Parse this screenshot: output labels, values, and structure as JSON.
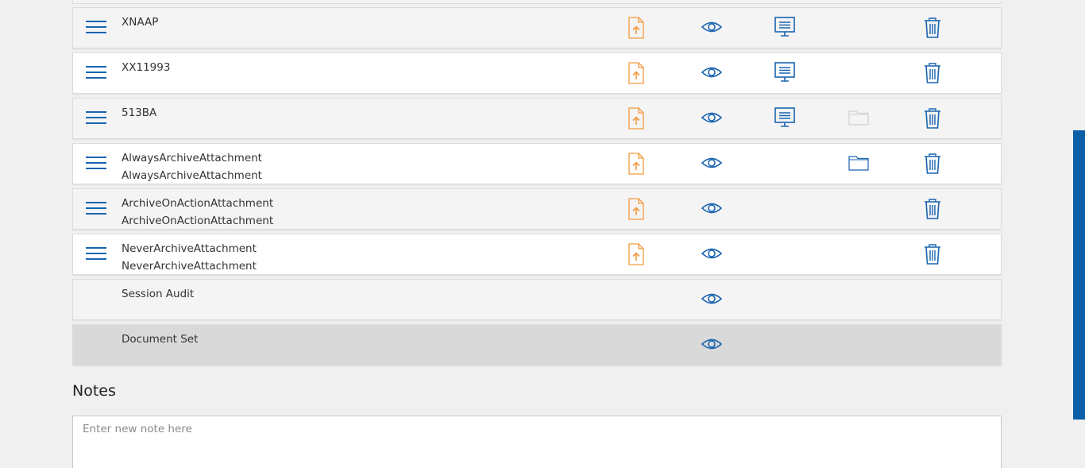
{
  "colors": {
    "accent": "#1a64b0",
    "upload": "#f39a3b",
    "folder_disabled": "#cfcfcf",
    "scrollbar": "#0b5ea8",
    "selected_row": "#d9d9d9"
  },
  "attachments": [
    {
      "line1": "XNAAP",
      "line2": "",
      "style": "gray",
      "icons": {
        "handle": true,
        "upload": true,
        "view": true,
        "present": true,
        "folder": "none",
        "delete": true
      }
    },
    {
      "line1": "XX11993",
      "line2": "",
      "style": "white",
      "icons": {
        "handle": true,
        "upload": true,
        "view": true,
        "present": true,
        "folder": "none",
        "delete": true
      }
    },
    {
      "line1": "513BA",
      "line2": "",
      "style": "gray",
      "icons": {
        "handle": true,
        "upload": true,
        "view": true,
        "present": true,
        "folder": "disabled",
        "delete": true
      }
    },
    {
      "line1": "AlwaysArchiveAttachment",
      "line2": "AlwaysArchiveAttachment",
      "style": "white",
      "icons": {
        "handle": true,
        "upload": true,
        "view": true,
        "present": false,
        "folder": "active",
        "delete": true
      }
    },
    {
      "line1": "ArchiveOnActionAttachment",
      "line2": "ArchiveOnActionAttachment",
      "style": "gray",
      "icons": {
        "handle": true,
        "upload": true,
        "view": true,
        "present": false,
        "folder": "none",
        "delete": true
      }
    },
    {
      "line1": "NeverArchiveAttachment",
      "line2": "NeverArchiveAttachment",
      "style": "white",
      "icons": {
        "handle": true,
        "upload": true,
        "view": true,
        "present": false,
        "folder": "none",
        "delete": true
      }
    },
    {
      "line1": "Session Audit",
      "line2": "",
      "style": "gray",
      "icons": {
        "handle": false,
        "upload": false,
        "view": true,
        "present": false,
        "folder": "none",
        "delete": false
      }
    },
    {
      "line1": "Document Set",
      "line2": "",
      "style": "selected",
      "icons": {
        "handle": false,
        "upload": false,
        "view": true,
        "present": false,
        "folder": "none",
        "delete": false
      }
    }
  ],
  "notes": {
    "heading": "Notes",
    "placeholder": "Enter new note here"
  }
}
